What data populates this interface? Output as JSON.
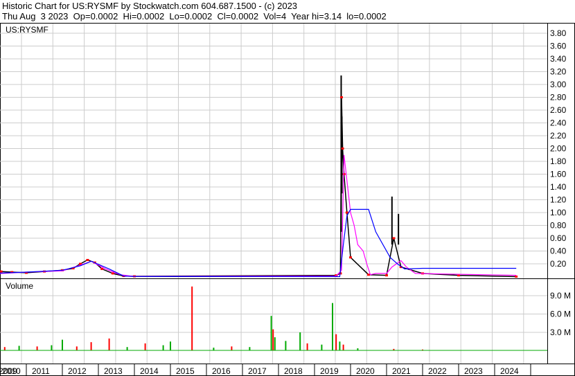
{
  "header": {
    "title": "Historic Chart for US:RYSMF by Stockwatch.com 604.687.1500 - (c) 2023",
    "quote": "Thu Aug  3 2023  Op=0.0002  Hi=0.0002  Lo=0.0002  Cl=0.0002  Vol=4  Year hi=3.14  lo=0.0002"
  },
  "chart_data": {
    "type": "line",
    "symbol_label": "US:RYSMF",
    "volume_label": "Volume",
    "price_ticks": [
      "0.20",
      "0.40",
      "0.60",
      "0.80",
      "1.00",
      "1.20",
      "1.40",
      "1.60",
      "1.80",
      "2.00",
      "2.20",
      "2.40",
      "2.60",
      "2.80",
      "3.00",
      "3.20",
      "3.40",
      "3.60",
      "3.80"
    ],
    "volume_ticks": [
      "3.0 M",
      "6.0 M",
      "9.0 M"
    ],
    "years": [
      "2009",
      "2010",
      "2011",
      "2012",
      "2013",
      "2014",
      "2015",
      "2016",
      "2017",
      "2018",
      "2019",
      "2020",
      "2021",
      "2022",
      "2023",
      "2024"
    ],
    "ylim": [
      0,
      3.9
    ],
    "colors": {
      "price": "#000000",
      "close": "#ff0000",
      "ma_short": "#ff00ff",
      "ma_long": "#0000ff",
      "vol_up": "#00aa00",
      "vol_down": "#ff0000"
    },
    "price": [
      [
        2009.0,
        0.05
      ],
      [
        2009.3,
        0.08
      ],
      [
        2009.6,
        0.07
      ],
      [
        2010.0,
        0.06
      ],
      [
        2010.5,
        0.08
      ],
      [
        2011.0,
        0.1
      ],
      [
        2011.3,
        0.13
      ],
      [
        2011.5,
        0.2
      ],
      [
        2011.7,
        0.26
      ],
      [
        2011.9,
        0.22
      ],
      [
        2012.1,
        0.12
      ],
      [
        2012.4,
        0.05
      ],
      [
        2012.7,
        0.01
      ],
      [
        2013.0,
        0.005
      ],
      [
        2018.6,
        0.02
      ],
      [
        2018.72,
        0.05
      ],
      [
        2018.75,
        2.8
      ],
      [
        2018.78,
        2.0
      ],
      [
        2018.82,
        1.6
      ],
      [
        2018.9,
        1.0
      ],
      [
        2019.0,
        0.3
      ],
      [
        2019.5,
        0.03
      ],
      [
        2020.0,
        0.02
      ],
      [
        2020.2,
        0.6
      ],
      [
        2020.4,
        0.15
      ],
      [
        2021.0,
        0.05
      ],
      [
        2022.0,
        0.02
      ],
      [
        2023.6,
        0.0002
      ]
    ],
    "high_spikes": [
      [
        2018.74,
        0.7,
        3.14
      ],
      [
        2018.76,
        1.3,
        2.5
      ],
      [
        2020.15,
        0.5,
        1.25
      ],
      [
        2020.33,
        0.5,
        0.98
      ]
    ],
    "ma_short": [
      [
        2009.0,
        0.04
      ],
      [
        2010.0,
        0.07
      ],
      [
        2011.0,
        0.09
      ],
      [
        2011.5,
        0.18
      ],
      [
        2011.8,
        0.24
      ],
      [
        2012.2,
        0.12
      ],
      [
        2012.6,
        0.03
      ],
      [
        2013.0,
        0.003
      ],
      [
        2018.6,
        0.01
      ],
      [
        2018.75,
        0.1
      ],
      [
        2018.82,
        1.9
      ],
      [
        2018.9,
        1.5
      ],
      [
        2019.0,
        1.0
      ],
      [
        2019.1,
        0.8
      ],
      [
        2019.2,
        0.5
      ],
      [
        2019.35,
        0.4
      ],
      [
        2019.45,
        0.2
      ],
      [
        2019.55,
        0.03
      ],
      [
        2019.7,
        0.05
      ],
      [
        2020.0,
        0.05
      ],
      [
        2020.15,
        0.15
      ],
      [
        2020.4,
        0.25
      ],
      [
        2020.55,
        0.15
      ],
      [
        2020.8,
        0.05
      ],
      [
        2023.6,
        0.02
      ]
    ],
    "ma_long": [
      [
        2009.0,
        0.05
      ],
      [
        2010.0,
        0.07
      ],
      [
        2011.0,
        0.1
      ],
      [
        2011.5,
        0.17
      ],
      [
        2011.8,
        0.24
      ],
      [
        2012.3,
        0.12
      ],
      [
        2012.7,
        0.01
      ],
      [
        2013.0,
        0.002
      ],
      [
        2018.7,
        0.0
      ],
      [
        2018.8,
        0.5
      ],
      [
        2018.9,
        0.95
      ],
      [
        2019.0,
        1.05
      ],
      [
        2019.5,
        1.05
      ],
      [
        2019.7,
        0.7
      ],
      [
        2019.9,
        0.5
      ],
      [
        2020.1,
        0.3
      ],
      [
        2020.3,
        0.2
      ],
      [
        2020.5,
        0.12
      ],
      [
        2021.0,
        0.13
      ],
      [
        2023.6,
        0.13
      ]
    ],
    "volume_millions": [
      [
        2009.0,
        1.5,
        "up"
      ],
      [
        2009.4,
        0.6,
        "down"
      ],
      [
        2009.8,
        0.8,
        "up"
      ],
      [
        2010.3,
        0.7,
        "down"
      ],
      [
        2010.7,
        0.9,
        "up"
      ],
      [
        2011.0,
        1.8,
        "up"
      ],
      [
        2011.4,
        0.7,
        "down"
      ],
      [
        2011.8,
        1.4,
        "down"
      ],
      [
        2012.3,
        2.0,
        "down"
      ],
      [
        2012.8,
        0.6,
        "up"
      ],
      [
        2013.3,
        1.2,
        "down"
      ],
      [
        2013.8,
        0.9,
        "up"
      ],
      [
        2014.0,
        1.5,
        "up"
      ],
      [
        2014.6,
        10.5,
        "down"
      ],
      [
        2015.2,
        0.5,
        "up"
      ],
      [
        2015.7,
        0.7,
        "down"
      ],
      [
        2016.2,
        0.6,
        "up"
      ],
      [
        2016.8,
        5.7,
        "up"
      ],
      [
        2016.85,
        3.5,
        "down"
      ],
      [
        2016.9,
        2.2,
        "up"
      ],
      [
        2017.2,
        1.6,
        "up"
      ],
      [
        2017.6,
        3.0,
        "up"
      ],
      [
        2017.8,
        1.2,
        "down"
      ],
      [
        2018.2,
        1.0,
        "up"
      ],
      [
        2018.5,
        7.8,
        "up"
      ],
      [
        2018.6,
        2.7,
        "down"
      ],
      [
        2018.7,
        1.5,
        "up"
      ],
      [
        2018.8,
        1.0,
        "down"
      ],
      [
        2019.2,
        0.4,
        "up"
      ],
      [
        2020.2,
        0.3,
        "down"
      ],
      [
        2021.0,
        0.2,
        "down"
      ],
      [
        2022.0,
        0.1,
        "up"
      ]
    ]
  }
}
